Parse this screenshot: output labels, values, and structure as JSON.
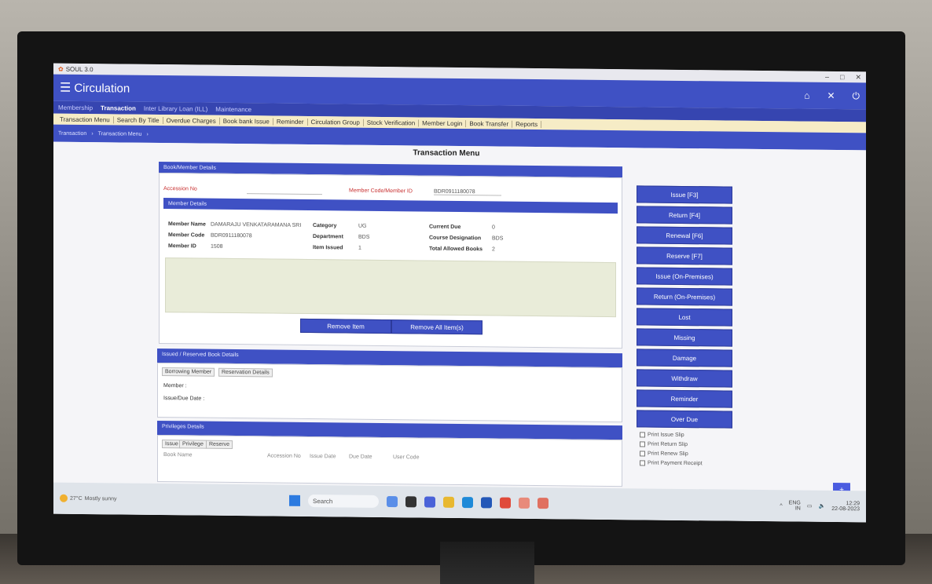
{
  "window": {
    "title": "SOUL 3.0",
    "controls": [
      "–",
      "□",
      "✕"
    ]
  },
  "header": {
    "title": "Circulation",
    "icons": [
      "home-icon",
      "close-icon",
      "power-icon"
    ]
  },
  "nav_primary": [
    {
      "label": "Membership"
    },
    {
      "label": "Transaction",
      "active": true
    },
    {
      "label": "Inter Library Loan (ILL)"
    },
    {
      "label": "Maintenance"
    }
  ],
  "nav_secondary": [
    "Transaction Menu",
    "Search By Title",
    "Overdue Charges",
    "Book bank Issue",
    "Reminder",
    "Circulation Group",
    "Stock Verification",
    "Member Login",
    "Book Transfer",
    "Reports"
  ],
  "breadcrumb": [
    "Transaction",
    "Transaction Menu"
  ],
  "page_title": "Transaction Menu",
  "book_member_details": {
    "heading": "Book/Member Details",
    "accession_label": "Accession No",
    "member_code_label": "Member Code/Member ID",
    "member_code_value": "BDR0911180078"
  },
  "member_details": {
    "heading": "Member Details",
    "member_name_label": "Member Name",
    "member_name_value": "DAMARAJU VENKATARAMANA SRI",
    "category_label": "Category",
    "category_value": "UG",
    "current_due_label": "Current Due",
    "current_due_value": "0",
    "member_code_label": "Member Code",
    "member_code_value": "BDR0911180078",
    "department_label": "Department",
    "department_value": "BDS",
    "course_label": "Course Designation",
    "course_value": "BDS",
    "member_id_label": "Member ID",
    "member_id_value": "1508",
    "item_issued_label": "Item Issued",
    "item_issued_value": "1",
    "total_allowed_label": "Total Allowed Books",
    "total_allowed_value": "2"
  },
  "buttons": {
    "remove_item": "Remove Item",
    "remove_all": "Remove All Item(s)"
  },
  "issued_reserved": {
    "heading": "Issued / Reserved Book Details",
    "tabs": [
      "Borrowing Member",
      "Reservation Details"
    ],
    "member_label": "Member :",
    "date_label": "Issue/Due Date :"
  },
  "privileges": {
    "heading": "Privileges Details",
    "tabs": [
      "Issue",
      "Privilege",
      "Reserve"
    ],
    "columns": [
      "Book Name",
      "Accession No",
      "Issue Date",
      "Due Date",
      "User Code"
    ]
  },
  "side_buttons": [
    "Issue [F3]",
    "Return [F4]",
    "Renewal [F6]",
    "Reserve [F7]",
    "Issue (On-Premises)",
    "Return (On-Premises)",
    "Lost",
    "Missing",
    "Damage",
    "Withdraw",
    "Reminder",
    "Over Due"
  ],
  "print_options": [
    "Print Issue Slip",
    "Print Return Slip",
    "Print Renew Slip",
    "Print Payment Receipt"
  ],
  "fab_label": "+",
  "taskbar": {
    "weather_temp": "27°C",
    "weather_desc": "Mostly sunny",
    "search_placeholder": "Search",
    "tray_lang": "ENG",
    "tray_region": "IN",
    "time": "12:29",
    "date": "22-08-2023"
  },
  "colors": {
    "primary": "#3f51c4",
    "tab_bar": "#f6ecc6",
    "required_label": "#c83030"
  }
}
